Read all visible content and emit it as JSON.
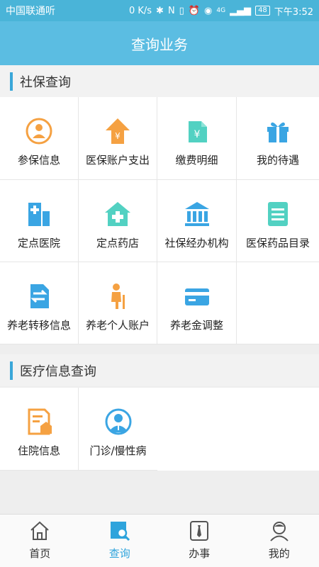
{
  "status_bar": {
    "carrier": "中国联通",
    "carrier_suffix": "听",
    "speed": "0 K/s",
    "network": "4G",
    "battery": "48",
    "time": "下午3:52"
  },
  "title_bar": {
    "title": "查询业务"
  },
  "sections": [
    {
      "title": "社保查询",
      "items": [
        {
          "label": "参保信息",
          "icon": "person-circle-icon"
        },
        {
          "label": "医保账户支出",
          "icon": "money-upload-icon"
        },
        {
          "label": "缴费明细",
          "icon": "yuan-document-icon"
        },
        {
          "label": "我的待遇",
          "icon": "gift-icon"
        },
        {
          "label": "定点医院",
          "icon": "hospital-icon"
        },
        {
          "label": "定点药店",
          "icon": "pharmacy-icon"
        },
        {
          "label": "社保经办机构",
          "icon": "institution-icon"
        },
        {
          "label": "医保药品目录",
          "icon": "list-document-icon"
        },
        {
          "label": "养老转移信息",
          "icon": "transfer-document-icon"
        },
        {
          "label": "养老个人账户",
          "icon": "elderly-person-icon"
        },
        {
          "label": "养老金调整",
          "icon": "bank-card-icon"
        }
      ]
    },
    {
      "title": "医疗信息查询",
      "items": [
        {
          "label": "住院信息",
          "icon": "hospitalization-document-icon"
        },
        {
          "label": "门诊/慢性病",
          "icon": "doctor-icon"
        }
      ]
    }
  ],
  "tabbar": {
    "tabs": [
      {
        "label": "首页",
        "icon": "home-icon",
        "active": false
      },
      {
        "label": "查询",
        "icon": "search-icon",
        "active": true
      },
      {
        "label": "办事",
        "icon": "tie-icon",
        "active": false
      },
      {
        "label": "我的",
        "icon": "user-icon",
        "active": false
      }
    ]
  },
  "colors": {
    "status_bar": "#4ab4d8",
    "title_bar": "#5bbde2",
    "accent": "#3aa7d9",
    "orange": "#f5a142",
    "teal": "#52d1c2",
    "blue": "#3aa5e3"
  }
}
